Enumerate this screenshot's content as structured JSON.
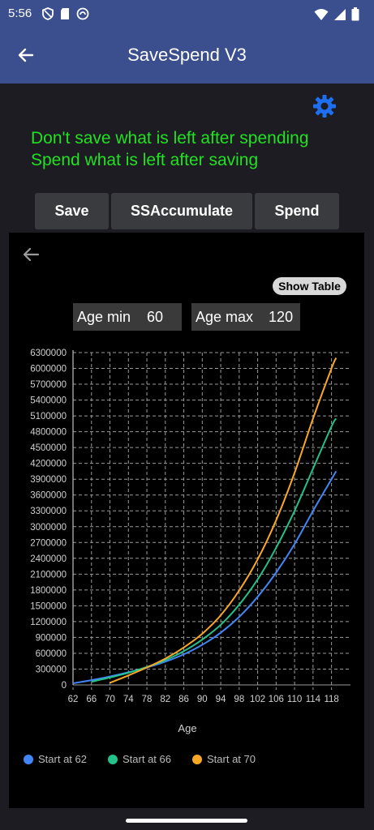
{
  "status": {
    "time": "5:56"
  },
  "app": {
    "title": "SaveSpend V3"
  },
  "quote": {
    "line1": "Don't save what is left after spending",
    "line2": "Spend what is left after saving"
  },
  "buttons": {
    "save": "Save",
    "accumulate": "SSAccumulate",
    "spend": "Spend"
  },
  "panel": {
    "show_table": "Show Table",
    "age_min_label": "Age min",
    "age_min_value": "60",
    "age_max_label": "Age max",
    "age_max_value": "120"
  },
  "colors": {
    "blue": "#4285f4",
    "green": "#24c28a",
    "orange": "#f9a825",
    "quote": "#22e022",
    "appbar": "#3b4f8e"
  },
  "icons": {
    "back": "arrow-left-icon",
    "settings": "gear-icon"
  },
  "chart_data": {
    "type": "line",
    "xlabel": "Age",
    "ylabel": "",
    "xlim": [
      62,
      120
    ],
    "ylim": [
      0,
      6300000
    ],
    "x_ticks": [
      62,
      66,
      70,
      74,
      78,
      82,
      86,
      90,
      94,
      98,
      102,
      106,
      110,
      114,
      118
    ],
    "y_ticks": [
      0,
      300000,
      600000,
      900000,
      1200000,
      1500000,
      1800000,
      2100000,
      2400000,
      2700000,
      3000000,
      3300000,
      3600000,
      3900000,
      4200000,
      4500000,
      4800000,
      5100000,
      5400000,
      5700000,
      6000000,
      6300000
    ],
    "grid": true,
    "legend_position": "bottom-left",
    "series": [
      {
        "name": "Start at 62",
        "color": "#4285f4",
        "x": [
          62,
          66,
          70,
          74,
          78,
          82,
          86,
          90,
          94,
          98,
          102,
          106,
          110,
          114,
          118,
          119
        ],
        "values": [
          30000,
          90000,
          160000,
          240000,
          330000,
          440000,
          580000,
          760000,
          990000,
          1290000,
          1670000,
          2130000,
          2670000,
          3300000,
          3900000,
          4050000
        ]
      },
      {
        "name": "Start at 66",
        "color": "#24c28a",
        "x": [
          66,
          70,
          74,
          78,
          82,
          86,
          90,
          94,
          98,
          102,
          106,
          110,
          114,
          118,
          119
        ],
        "values": [
          60000,
          140000,
          230000,
          340000,
          470000,
          640000,
          860000,
          1140000,
          1520000,
          2000000,
          2600000,
          3300000,
          4100000,
          4900000,
          5050000
        ]
      },
      {
        "name": "Start at 70",
        "color": "#f9a825",
        "x": [
          70,
          74,
          78,
          82,
          86,
          90,
          94,
          98,
          102,
          106,
          110,
          114,
          118,
          119
        ],
        "values": [
          40000,
          180000,
          330000,
          500000,
          710000,
          970000,
          1320000,
          1790000,
          2380000,
          3120000,
          4020000,
          5050000,
          6000000,
          6200000
        ]
      }
    ]
  }
}
